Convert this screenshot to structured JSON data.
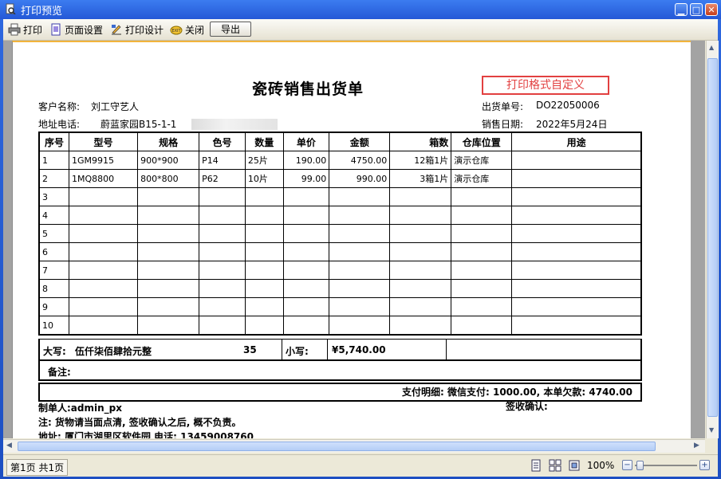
{
  "window": {
    "title": "打印预览"
  },
  "toolbar": {
    "print": "打印",
    "page_setup": "页面设置",
    "print_design": "打印设计",
    "close": "关闭",
    "export": "导出"
  },
  "doc": {
    "title": "瓷砖销售出货单",
    "custom_label": "打印格式自定义",
    "customer_label": "客户名称:",
    "customer": "刘工守艺人",
    "address_label": "地址电话:",
    "address": "蔚蓝家园B15-1-1",
    "order_no_label": "出货单号:",
    "order_no": "DO22050006",
    "date_label": "销售日期:",
    "date": "2022年5月24日"
  },
  "table": {
    "headers": [
      "序号",
      "型号",
      "规格",
      "色号",
      "数量",
      "单价",
      "金额",
      "箱数",
      "仓库位置",
      "用途"
    ],
    "rows": [
      [
        "1",
        "1GM9915",
        "900*900",
        "P14",
        "25片",
        "190.00",
        "4750.00",
        "12箱1片",
        "演示仓库",
        ""
      ],
      [
        "2",
        "1MQ8800",
        "800*800",
        "P62",
        "10片",
        "99.00",
        "990.00",
        "3箱1片",
        "演示仓库",
        ""
      ],
      [
        "3",
        "",
        "",
        "",
        "",
        "",
        "",
        "",
        "",
        ""
      ],
      [
        "4",
        "",
        "",
        "",
        "",
        "",
        "",
        "",
        "",
        ""
      ],
      [
        "5",
        "",
        "",
        "",
        "",
        "",
        "",
        "",
        "",
        ""
      ],
      [
        "6",
        "",
        "",
        "",
        "",
        "",
        "",
        "",
        "",
        ""
      ],
      [
        "7",
        "",
        "",
        "",
        "",
        "",
        "",
        "",
        "",
        ""
      ],
      [
        "8",
        "",
        "",
        "",
        "",
        "",
        "",
        "",
        "",
        ""
      ],
      [
        "9",
        "",
        "",
        "",
        "",
        "",
        "",
        "",
        "",
        ""
      ],
      [
        "10",
        "",
        "",
        "",
        "",
        "",
        "",
        "",
        "",
        ""
      ]
    ]
  },
  "summary": {
    "upper_label": "大写:",
    "upper_amount": "伍仟柒佰肆拾元整",
    "total_qty": "35",
    "lower_label": "小写:",
    "lower_amount": "¥5,740.00",
    "remark_label": "备注:",
    "payment": "支付明细: 微信支付: 1000.00, 本单欠款: 4740.00"
  },
  "footer": {
    "maker": "制单人:admin_px",
    "sign": "签收确认:",
    "note": "注: 货物请当面点清, 签收确认之后, 概不负责。",
    "company_address": "地址: 厦门市湖里区软件园 电话: 13459008760"
  },
  "status": {
    "page_info": "第1页 共1页",
    "zoom": "100%",
    "zoom_level_percent": 100
  },
  "colors": {
    "accent_red": "#e24040",
    "title_blue": "#2458d6"
  }
}
